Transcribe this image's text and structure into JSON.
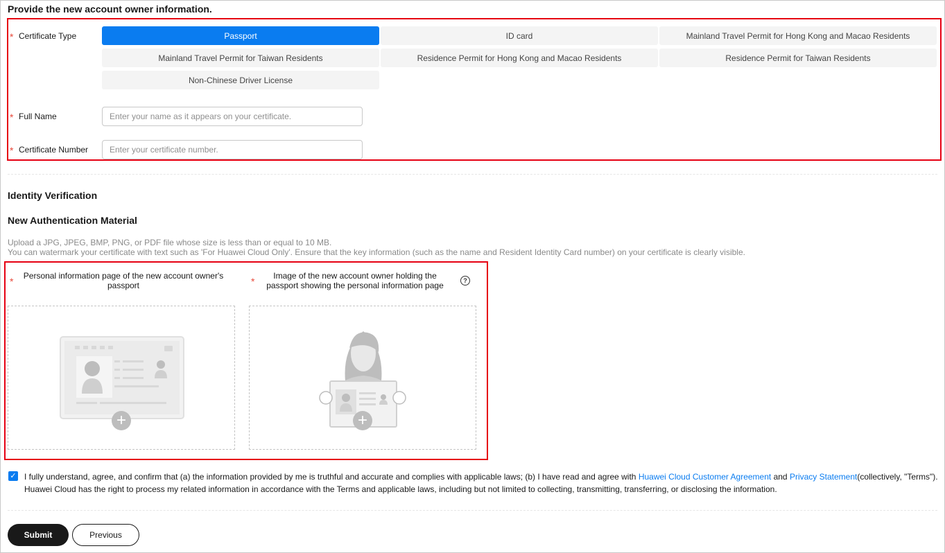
{
  "owner_section": {
    "title": "Provide the new account owner information.",
    "certificate_type_label": "Certificate Type",
    "certificate_types": [
      {
        "label": "Passport",
        "selected": true
      },
      {
        "label": "ID card",
        "selected": false
      },
      {
        "label": "Mainland Travel Permit for Hong Kong and Macao Residents",
        "selected": false
      },
      {
        "label": "Mainland Travel Permit for Taiwan Residents",
        "selected": false
      },
      {
        "label": "Residence Permit for Hong Kong and Macao Residents",
        "selected": false
      },
      {
        "label": "Residence Permit for Taiwan Residents",
        "selected": false
      },
      {
        "label": "Non-Chinese Driver License",
        "selected": false
      }
    ],
    "full_name_label": "Full Name",
    "full_name_placeholder": "Enter your name as it appears on your certificate.",
    "full_name_value": "",
    "cert_number_label": "Certificate Number",
    "cert_number_placeholder": "Enter your certificate number.",
    "cert_number_value": "",
    "required_mark": "*"
  },
  "identity_section": {
    "title": "Identity Verification",
    "material_title": "New Authentication Material",
    "desc_line1": "Upload a JPG, JPEG, BMP, PNG, or PDF file whose size is less than or equal to 10 MB.",
    "desc_line2": "You can watermark your certificate with text such as 'For Huawei Cloud Only'. Ensure that the key information (such as the name and Resident Identity Card number) on your certificate is clearly visible.",
    "uploads": [
      {
        "label": "Personal information page of the new account owner's passport",
        "icon": "passport-page-illustration"
      },
      {
        "label": "Image of the new account owner holding the passport showing the personal information page",
        "icon": "person-holding-passport-illustration",
        "help": "?"
      }
    ],
    "add_symbol": "+"
  },
  "agreement": {
    "checked": true,
    "check_symbol": "✓",
    "text_before": "I fully understand, agree, and confirm that (a) the information provided by me is truthful and accurate and complies with applicable laws; (b) I have read and agree with ",
    "link1": "Huawei Cloud Customer Agreement",
    "text_mid": " and ",
    "link2": "Privacy Statement",
    "text_after": "(collectively, \"Terms\"). Huawei Cloud has the right to process my related information in accordance with the Terms and applicable laws, including but not limited to collecting, transmitting, transferring, or disclosing the information."
  },
  "actions": {
    "submit": "Submit",
    "previous": "Previous"
  },
  "colors": {
    "accent": "#0a7cf0",
    "highlight_border": "#e60012",
    "required": "#e84a3c"
  }
}
